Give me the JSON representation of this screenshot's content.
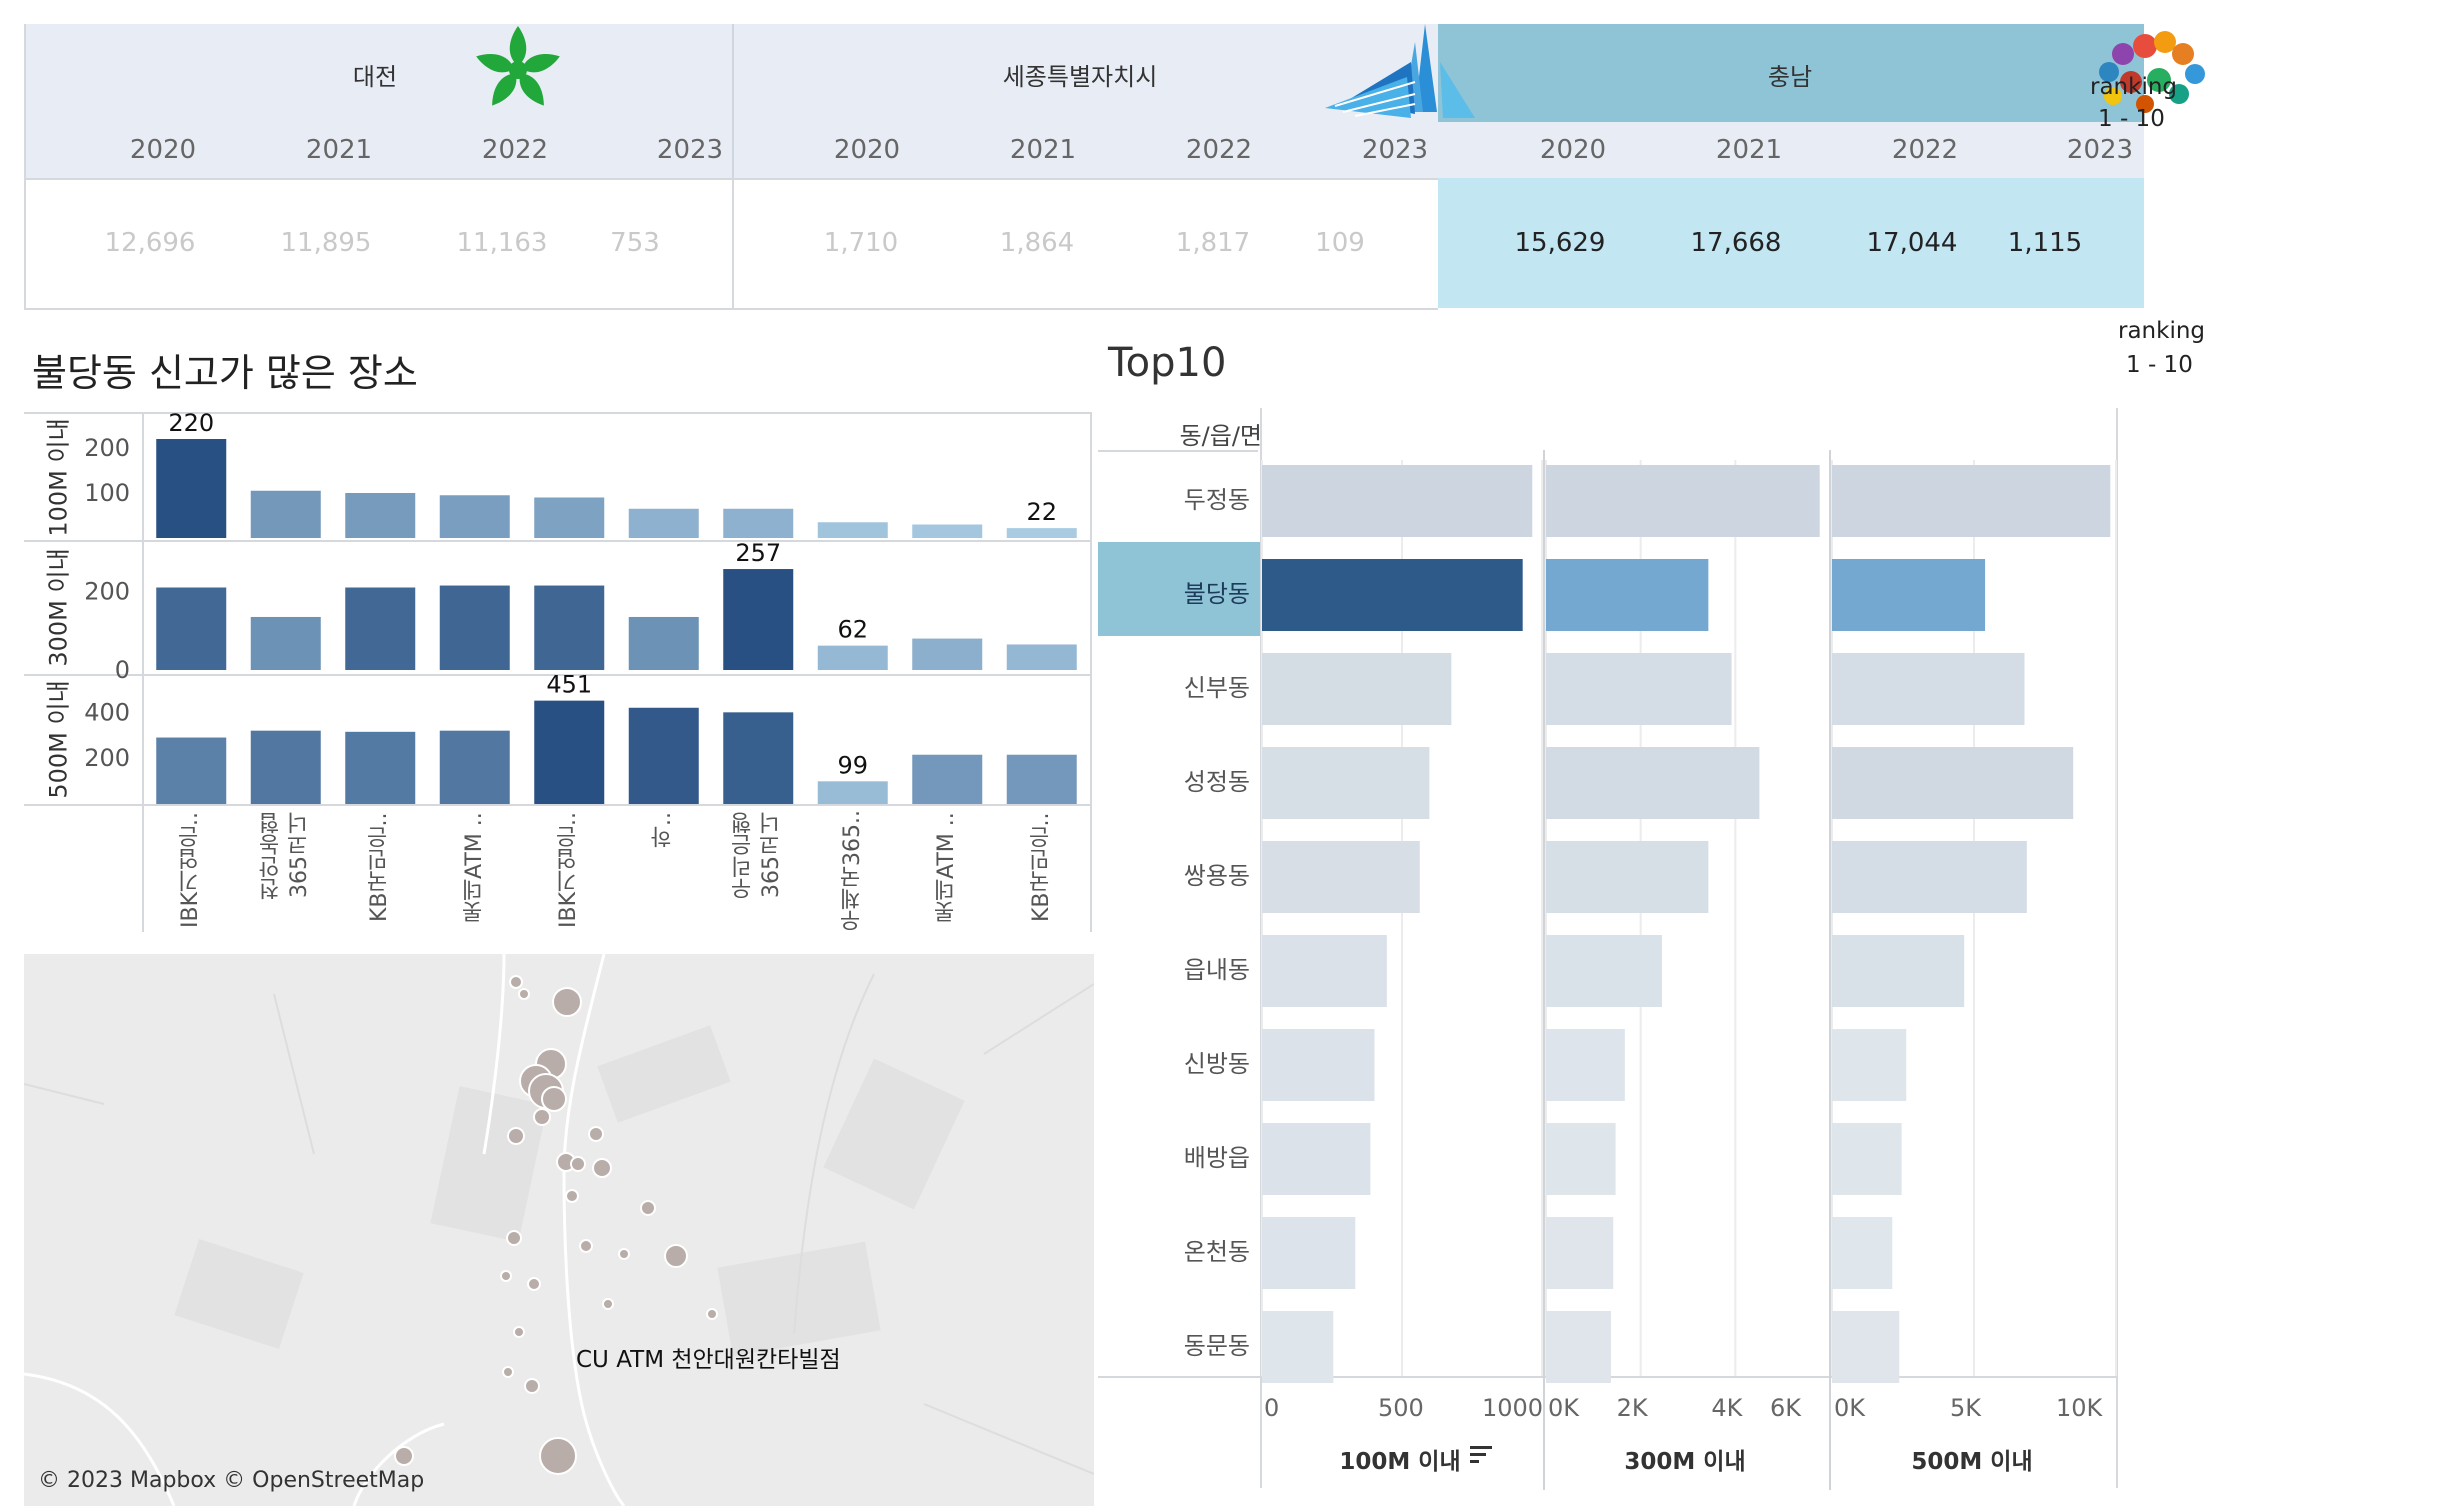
{
  "summary": {
    "regions": [
      {
        "name": "대전",
        "years": [
          "2020",
          "2021",
          "2022",
          "2023"
        ],
        "values": [
          "12,696",
          "11,895",
          "11,163",
          "753"
        ],
        "highlighted": false
      },
      {
        "name": "세종특별자치시",
        "years": [
          "2020",
          "2021",
          "2022",
          "2023"
        ],
        "values": [
          "1,710",
          "1,864",
          "1,817",
          "109"
        ],
        "highlighted": false
      },
      {
        "name": "충남",
        "years": [
          "2020",
          "2021",
          "2022",
          "2023"
        ],
        "values": [
          "15,629",
          "17,668",
          "17,044",
          "1,115"
        ],
        "highlighted": true
      }
    ],
    "colors": {
      "header_bg": "#e8edf5",
      "active_header_bg": "#8ec4d6",
      "active_value_bg": "#c3e6f3"
    }
  },
  "ranking": {
    "label": "ranking",
    "range": "1 - 10"
  },
  "left_title": "불당동 신고가 많은 장소",
  "right_title": "Top10",
  "chart_data": [
    {
      "type": "bar",
      "categories": [
        "IBK기업은..",
        "천안농협\n365코너",
        "KB국민은..",
        "롯데ATM ..",
        "IBK기업은..",
        "하..",
        "우리은행\n365코너",
        "우체국365..",
        "롯데ATM ..",
        "KB국민은.."
      ],
      "series": [
        {
          "name": "100M 이내",
          "values": [
            220,
            105,
            100,
            95,
            90,
            65,
            65,
            35,
            30,
            22
          ],
          "ylim": [
            0,
            240
          ],
          "yticks": [
            "200",
            "100"
          ],
          "labels": {
            "0": "220",
            "9": "22"
          }
        },
        {
          "name": "300M 이내",
          "values": [
            210,
            135,
            210,
            215,
            215,
            135,
            257,
            62,
            80,
            65
          ],
          "ylim": [
            0,
            280
          ],
          "yticks": [
            "200",
            "0"
          ],
          "labels": {
            "6": "257",
            "7": "62"
          }
        },
        {
          "name": "500M 이내",
          "values": [
            290,
            320,
            315,
            320,
            451,
            420,
            400,
            99,
            215,
            215
          ],
          "ylim": [
            0,
            480
          ],
          "yticks": [
            "400",
            "200"
          ],
          "labels": {
            "4": "451",
            "7": "99"
          }
        }
      ]
    },
    {
      "type": "bar",
      "orientation": "horizontal",
      "row_header": "동/읍/면",
      "categories": [
        "두정동",
        "불당동",
        "신부동",
        "성정동",
        "쌍용동",
        "읍내동",
        "신방동",
        "배방읍",
        "온천동",
        "동문동"
      ],
      "highlight": "불당동",
      "series": [
        {
          "name": "100M 이내",
          "values": [
            985,
            950,
            690,
            610,
            575,
            455,
            410,
            395,
            340,
            260
          ],
          "xlim": [
            0,
            1000
          ],
          "xticks": [
            "0",
            "500",
            "1000"
          ]
        },
        {
          "name": "300M 이내",
          "values": [
            5900,
            3500,
            4000,
            4600,
            3500,
            2500,
            1700,
            1500,
            1450,
            1400
          ],
          "xlim": [
            0,
            6000
          ],
          "xticks": [
            "0K",
            "2K",
            "4K",
            "6K"
          ]
        },
        {
          "name": "500M 이내",
          "values": [
            12000,
            6600,
            8300,
            10400,
            8400,
            5700,
            3200,
            3000,
            2600,
            2900
          ],
          "xlim": [
            0,
            12000
          ],
          "xticks": [
            "0K",
            "5K",
            "10K"
          ]
        }
      ]
    }
  ],
  "map": {
    "label": "CU ATM 천안대원칸타빌점",
    "attribution": "© 2023 Mapbox © OpenStreetMap"
  }
}
